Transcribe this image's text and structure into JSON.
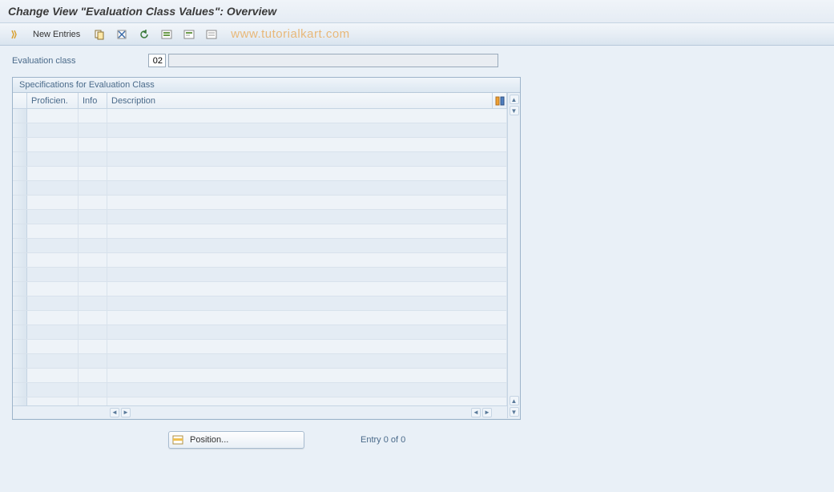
{
  "title": "Change View \"Evaluation Class Values\": Overview",
  "toolbar": {
    "new_entries_label": "New Entries"
  },
  "watermark": "www.tutorialkart.com",
  "field": {
    "label": "Evaluation class",
    "value": "02",
    "long_value": ""
  },
  "panel": {
    "title": "Specifications for Evaluation Class",
    "columns": {
      "proficien": "Proficien.",
      "info": "Info",
      "description": "Description"
    },
    "rows_count": 21
  },
  "footer": {
    "position_label": "Position...",
    "entry_text": "Entry 0 of 0"
  }
}
